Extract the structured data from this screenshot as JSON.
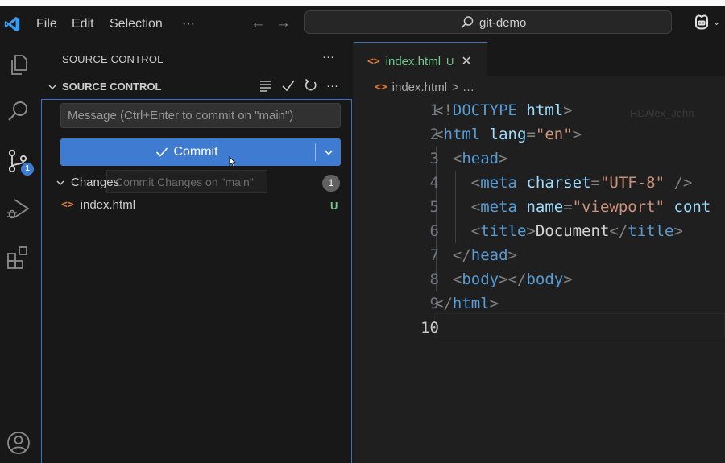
{
  "titlebar": {
    "menus": [
      "File",
      "Edit",
      "Selection",
      "···"
    ],
    "back_icon": "arrow-left-icon",
    "forward_icon": "arrow-right-icon",
    "search_text": "git-demo"
  },
  "activity": {
    "items": [
      "explorer-icon",
      "search-icon",
      "source-control-icon",
      "run-debug-icon",
      "extensions-icon",
      "account-icon"
    ],
    "source_control_badge": "1"
  },
  "sidebar": {
    "title": "SOURCE CONTROL",
    "more": "···",
    "section_header": "SOURCE CONTROL",
    "message_placeholder": "Message (Ctrl+Enter to commit on \"main\")",
    "commit_label": "Commit",
    "tooltip": "Commit Changes on \"main\"",
    "changes_label": "Changes",
    "changes_count": "1",
    "files": [
      {
        "name": "index.html",
        "status": "U"
      }
    ]
  },
  "editor": {
    "tab": {
      "name": "index.html",
      "status": "U"
    },
    "breadcrumb": {
      "file": "index.html",
      "rest": "> …"
    },
    "watermark": "HDAlex_John",
    "lines": [
      {
        "n": "1",
        "indent": "",
        "tokens": [
          [
            "p",
            "<!"
          ],
          [
            "tag",
            "DOCTYPE"
          ],
          [
            "p",
            " "
          ],
          [
            "attr",
            "html"
          ],
          [
            "p",
            ">"
          ]
        ]
      },
      {
        "n": "2",
        "indent": "",
        "tokens": [
          [
            "p",
            "<"
          ],
          [
            "tag",
            "html"
          ],
          [
            "p",
            " "
          ],
          [
            "attr",
            "lang"
          ],
          [
            "p",
            "="
          ],
          [
            "str",
            "\"en\""
          ],
          [
            "p",
            ">"
          ]
        ]
      },
      {
        "n": "3",
        "indent": "  ",
        "tokens": [
          [
            "p",
            "<"
          ],
          [
            "tag",
            "head"
          ],
          [
            "p",
            ">"
          ]
        ]
      },
      {
        "n": "4",
        "indent": "    ",
        "tokens": [
          [
            "p",
            "<"
          ],
          [
            "tag",
            "meta"
          ],
          [
            "p",
            " "
          ],
          [
            "attr",
            "charset"
          ],
          [
            "p",
            "="
          ],
          [
            "str",
            "\"UTF-8\""
          ],
          [
            "p",
            " />"
          ]
        ]
      },
      {
        "n": "5",
        "indent": "    ",
        "tokens": [
          [
            "p",
            "<"
          ],
          [
            "tag",
            "meta"
          ],
          [
            "p",
            " "
          ],
          [
            "attr",
            "name"
          ],
          [
            "p",
            "="
          ],
          [
            "str",
            "\"viewport\""
          ],
          [
            "p",
            " "
          ],
          [
            "attr",
            "cont"
          ]
        ]
      },
      {
        "n": "6",
        "indent": "    ",
        "tokens": [
          [
            "p",
            "<"
          ],
          [
            "tag",
            "title"
          ],
          [
            "p",
            ">"
          ],
          [
            "text",
            "Document"
          ],
          [
            "p",
            "</"
          ],
          [
            "tag",
            "title"
          ],
          [
            "p",
            ">"
          ]
        ]
      },
      {
        "n": "7",
        "indent": "  ",
        "tokens": [
          [
            "p",
            "</"
          ],
          [
            "tag",
            "head"
          ],
          [
            "p",
            ">"
          ]
        ]
      },
      {
        "n": "8",
        "indent": "  ",
        "tokens": [
          [
            "p",
            "<"
          ],
          [
            "tag",
            "body"
          ],
          [
            "p",
            "></"
          ],
          [
            "tag",
            "body"
          ],
          [
            "p",
            ">"
          ]
        ]
      },
      {
        "n": "9",
        "indent": "",
        "tokens": [
          [
            "p",
            "</"
          ],
          [
            "tag",
            "html"
          ],
          [
            "p",
            ">"
          ]
        ]
      },
      {
        "n": "10",
        "indent": "",
        "tokens": []
      }
    ],
    "active_line": "10"
  },
  "colors": {
    "accent": "#3e7bd1",
    "untracked": "#73c991",
    "html_icon": "#e37933"
  }
}
